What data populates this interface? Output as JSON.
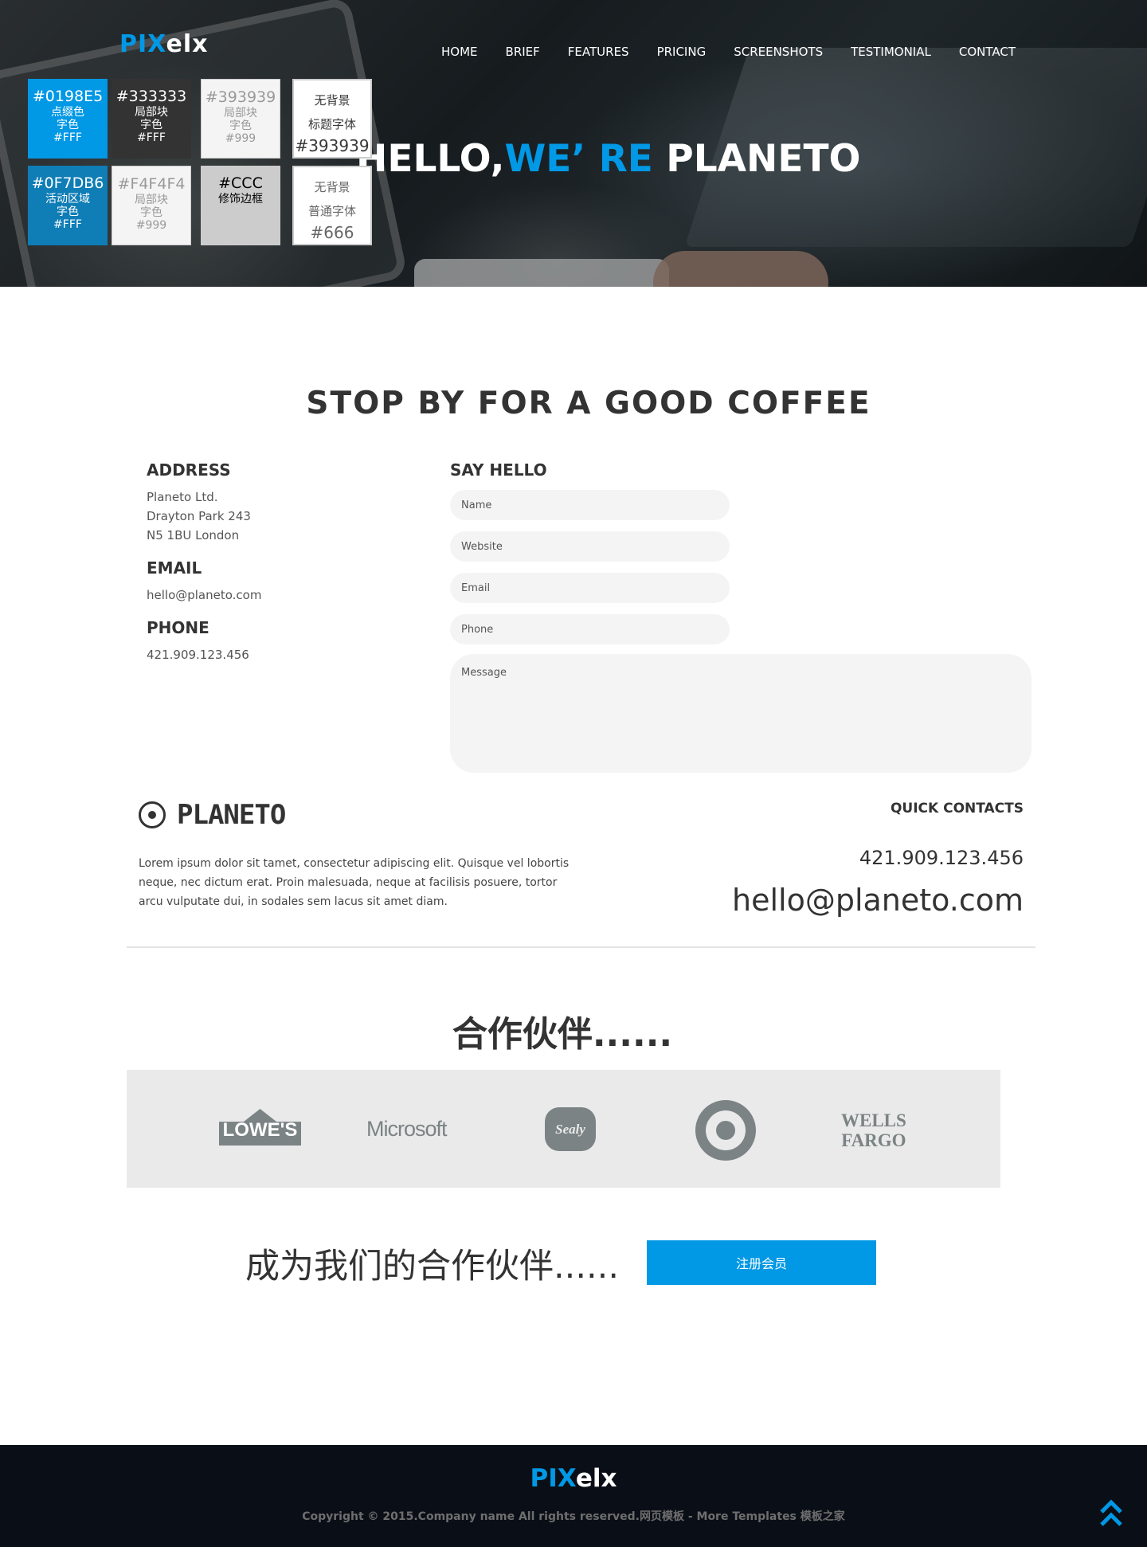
{
  "header": {
    "logo": {
      "accent": "PIX",
      "rest": "elx"
    },
    "nav": [
      "HOME",
      "BRIEF",
      "FEATURES",
      "PRICING",
      "SCREENSHOTS",
      "TESTIMONIAL",
      "CONTACT"
    ],
    "hero_title": {
      "part1": "HELLO,",
      "highlight": "WE’ RE",
      "part2": " PLANETO"
    }
  },
  "swatches": [
    {
      "code": "#0198E5",
      "line1": "点缀色",
      "line2": "字色",
      "line3": "#FFF"
    },
    {
      "code": "#333333",
      "line1": "局部块",
      "line2": "字色",
      "line3": "#FFF"
    },
    {
      "code": "#393939",
      "line1": "局部块",
      "line2": "字色",
      "line3": "#999"
    },
    {
      "line1": "无背景",
      "line2": "标题字体",
      "code": "#393939"
    },
    {
      "code": "#0F7DB6",
      "line1": "活动区域",
      "line2": "字色",
      "line3": "#FFF"
    },
    {
      "code": "#F4F4F4",
      "line1": "局部块",
      "line2": "字色",
      "line3": "#999"
    },
    {
      "code": "#CCC",
      "line1": "修饰边框"
    },
    {
      "line1": "无背景",
      "line2": "普通字体",
      "code": "#666"
    }
  ],
  "contact": {
    "title": "STOP BY FOR A GOOD COFFEE",
    "address_head": "ADDRESS",
    "address_lines": [
      "Planeto Ltd.",
      "Drayton Park 243",
      "N5 1BU London"
    ],
    "email_head": "EMAIL",
    "email": "hello@planeto.com",
    "phone_head": "PHONE",
    "phone": "421.909.123.456",
    "form_head": "SAY HELLO",
    "placeholders": {
      "name": "Name",
      "website": "Website",
      "email": "Email",
      "phone": "Phone",
      "message": "Message"
    }
  },
  "footer_info": {
    "brand": "PLANETO",
    "lorem": "Lorem ipsum dolor sit tamet, consectetur adipiscing elit. Quisque vel lobortis neque, nec dictum erat. Proin malesuada, neque at facilisis posuere, tortor arcu vulputate dui, in sodales sem lacus sit amet diam.",
    "quick_contacts": "QUICK CONTACTS",
    "phone": "421.909.123.456",
    "email": "hello@planeto.com"
  },
  "partners": {
    "title": "合作伙伴......",
    "logos": {
      "lowes": "LOWE'S",
      "microsoft": "Microsoft",
      "sealy": "Sealy",
      "wells_line1": "WELLS",
      "wells_line2": "FARGO"
    }
  },
  "cta": {
    "text": "成为我们的合作伙伴......",
    "button": "注册会员"
  },
  "footer": {
    "logo": {
      "accent": "PIX",
      "rest": "elx"
    },
    "copyright": "Copyright © 2015.Company name All rights reserved.网页模板 - More Templates 模板之家"
  },
  "colors": {
    "accent": "#0198E5",
    "active": "#0F7DB6",
    "dark": "#333333",
    "footer_bg": "#0a0f17",
    "field_bg": "#F4F4F4"
  }
}
